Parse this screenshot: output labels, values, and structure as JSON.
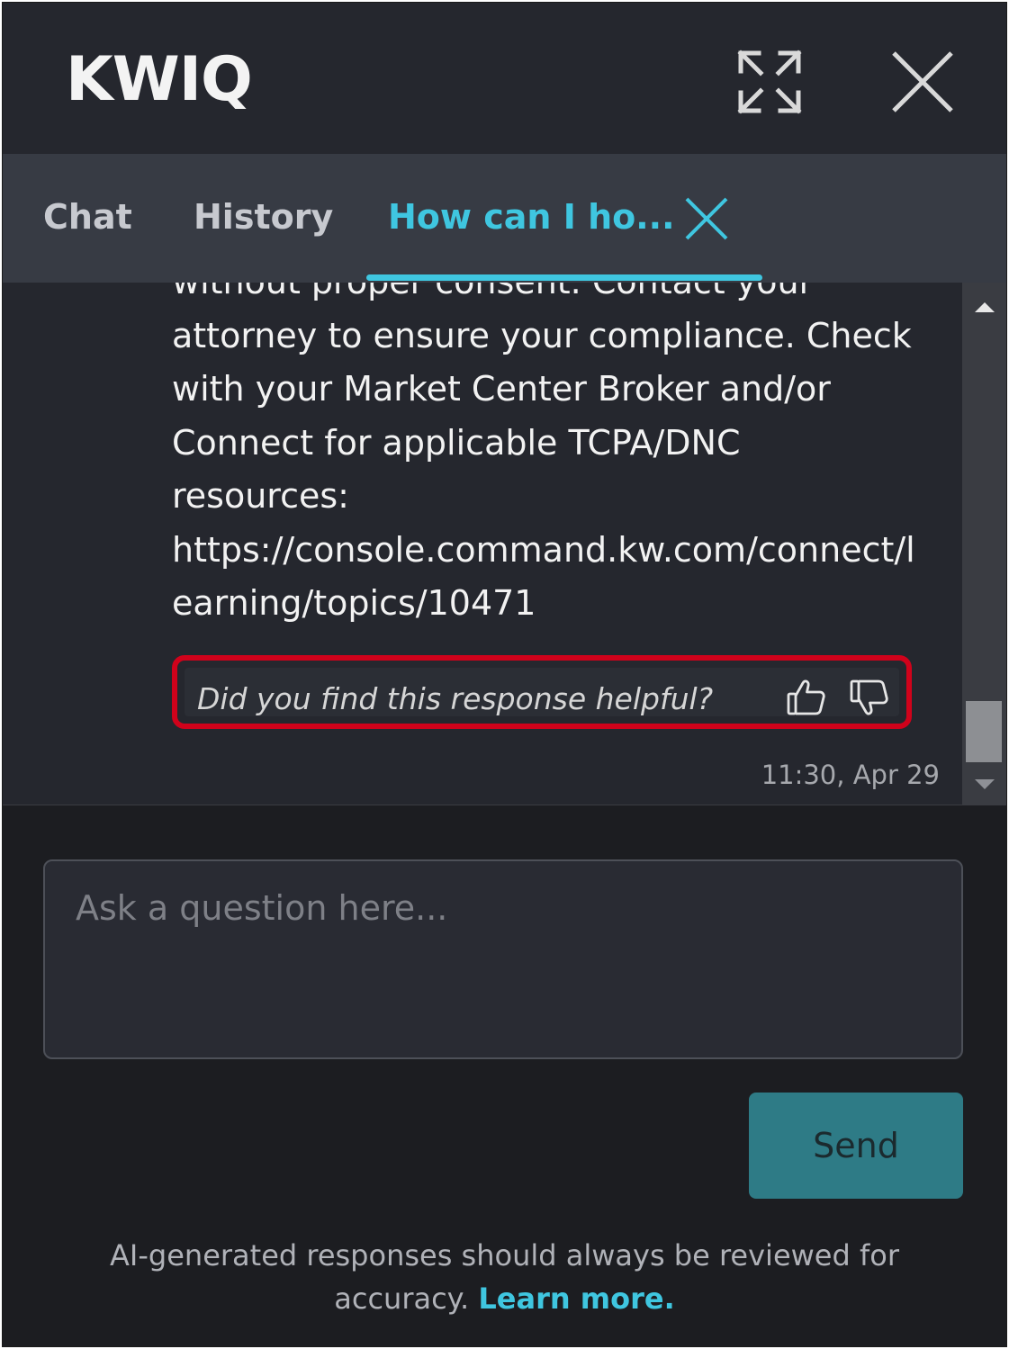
{
  "header": {
    "title": "KWIQ",
    "expand_icon": "expand-arrows-icon",
    "close_icon": "close-icon"
  },
  "tabs": [
    {
      "label": "Chat",
      "active": false
    },
    {
      "label": "History",
      "active": false
    },
    {
      "label": "How can I ho...",
      "active": true
    }
  ],
  "message": {
    "lines": [
      "without proper consent. Contact your",
      "attorney to ensure your compliance. Check",
      "with your Market Center Broker and/or",
      "Connect for applicable TCPA/DNC",
      "resources:",
      "https://console.command.kw.com/connect/l",
      "earning/topics/10471"
    ],
    "feedback_prompt": "Did you find this response helpful?",
    "timestamp": "11:30, Apr 29"
  },
  "composer": {
    "placeholder": "Ask a question here...",
    "send_label": "Send"
  },
  "footer": {
    "disclaimer": "AI-generated responses should always be reviewed for accuracy.",
    "learn_more": "Learn more."
  },
  "colors": {
    "accent": "#3fc6e0",
    "highlight_border": "#d0021b",
    "send_button": "#2e7b86"
  }
}
